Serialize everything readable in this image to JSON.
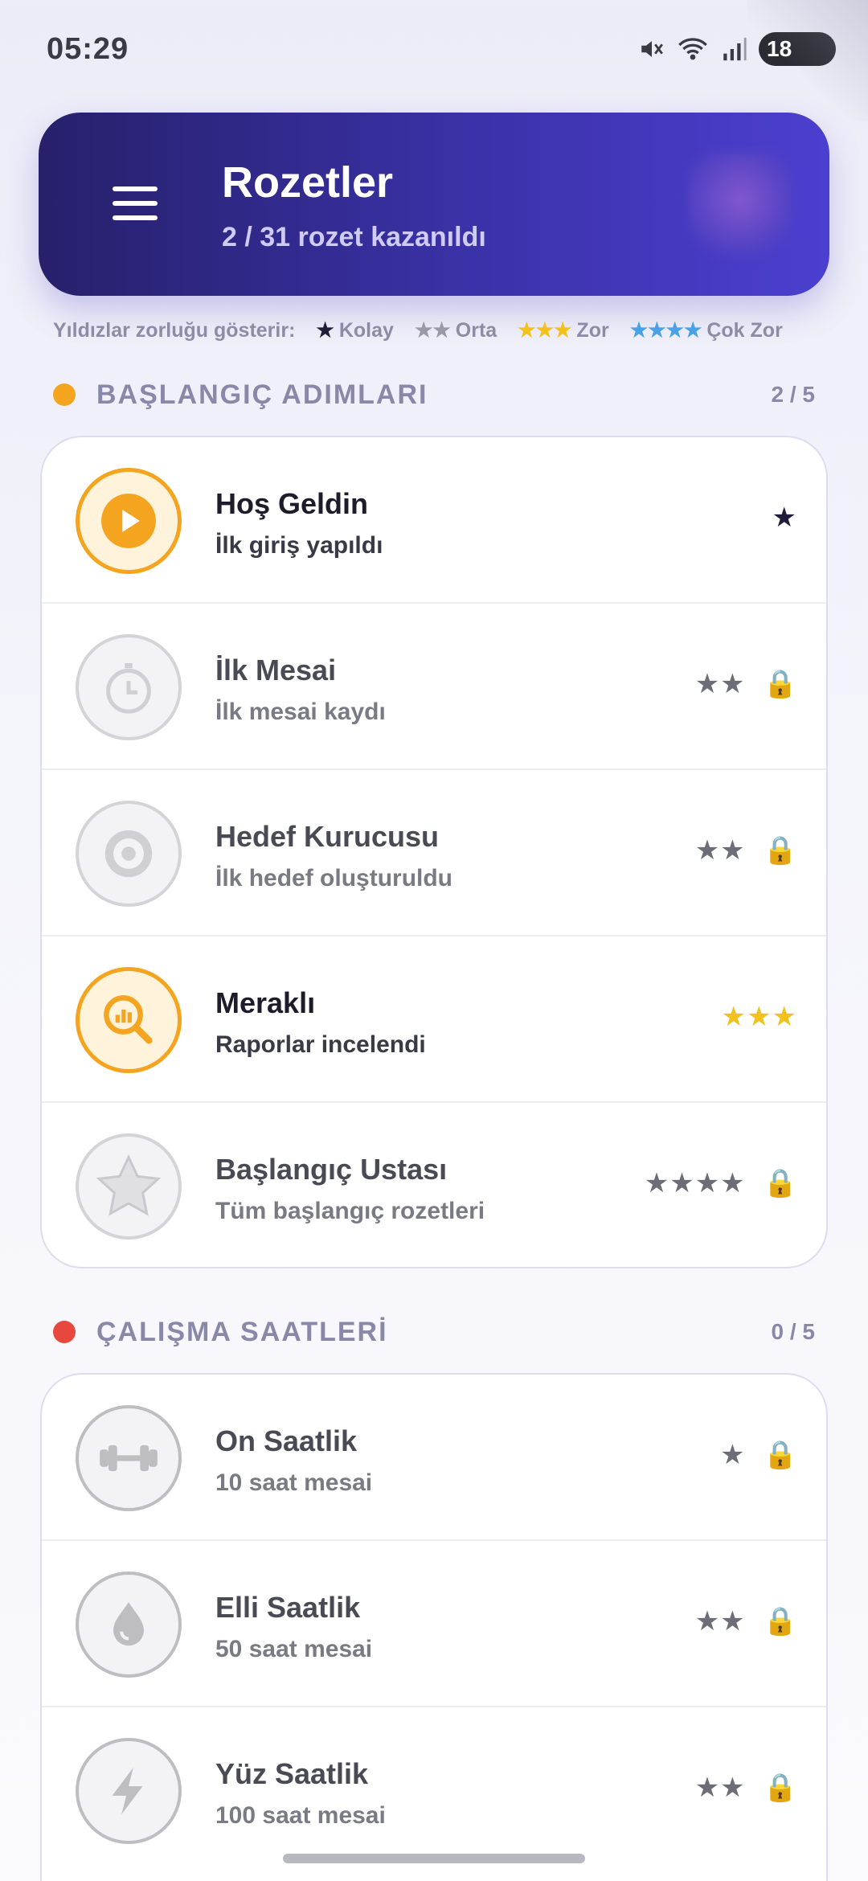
{
  "status": {
    "time": "05:29",
    "battery": "18"
  },
  "header": {
    "title": "Rozetler",
    "subtitle": "2 / 31 rozet kazanıldı"
  },
  "legend": {
    "intro": "Yıldızlar zorluğu gösterir:",
    "items": [
      {
        "stars": "★",
        "label": "Kolay",
        "color": "#1f1d3a"
      },
      {
        "stars": "★★",
        "label": "Orta",
        "color": "#9a9aa6"
      },
      {
        "stars": "★★★",
        "label": "Zor",
        "color": "#f2c21a"
      },
      {
        "stars": "★★★★",
        "label": "Çok Zor",
        "color": "#4aa2e6"
      }
    ]
  },
  "sections": [
    {
      "title": "BAŞLANGIÇ ADIMLARI",
      "count": "2 / 5",
      "dot_color": "#f4a41e",
      "badges": [
        {
          "title": "Hoş Geldin",
          "subtitle": "İlk giriş yapıldı",
          "stars": "★",
          "earned": true,
          "icon": "play-icon"
        },
        {
          "title": "İlk Mesai",
          "subtitle": "İlk mesai kaydı",
          "stars": "★★",
          "earned": false,
          "icon": "stopwatch-icon"
        },
        {
          "title": "Hedef Kurucusu",
          "subtitle": "İlk hedef oluşturuldu",
          "stars": "★★",
          "earned": false,
          "icon": "target-icon"
        },
        {
          "title": "Meraklı",
          "subtitle": "Raporlar incelendi",
          "stars": "★★★",
          "earned": true,
          "icon": "report-search-icon"
        },
        {
          "title": "Başlangıç Ustası",
          "subtitle": "Tüm başlangıç rozetleri",
          "stars": "★★★★",
          "earned": false,
          "icon": "star-icon"
        }
      ]
    },
    {
      "title": "ÇALIŞMA SAATLERİ",
      "count": "0 / 5",
      "dot_color": "#e8473d",
      "badges": [
        {
          "title": "On Saatlik",
          "subtitle": "10 saat mesai",
          "stars": "★",
          "earned": false,
          "icon": "dumbbell-icon"
        },
        {
          "title": "Elli Saatlik",
          "subtitle": "50 saat mesai",
          "stars": "★★",
          "earned": false,
          "icon": "drop-icon"
        },
        {
          "title": "Yüz Saatlik",
          "subtitle": "100 saat mesai",
          "stars": "★★",
          "earned": false,
          "icon": "bolt-icon"
        }
      ]
    }
  ],
  "lock_icon": "🔒"
}
